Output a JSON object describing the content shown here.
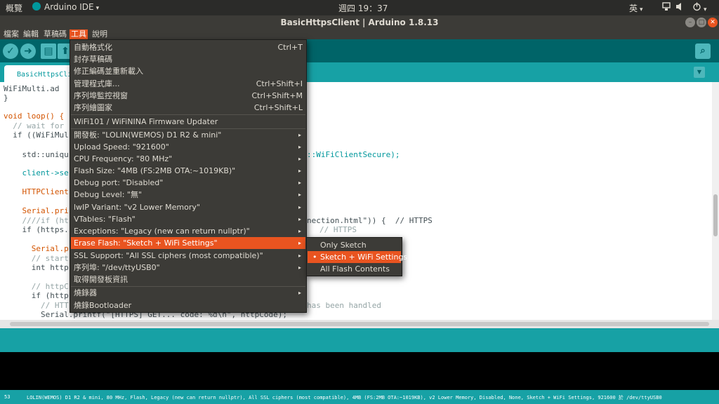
{
  "top_panel": {
    "activities": "概覽",
    "app_name": "Arduino IDE",
    "clock": "週四 19：37",
    "input_method": "英",
    "dropdown_arrow": "▾"
  },
  "window": {
    "title": "BasicHttpsClient | Arduino 1.8.13"
  },
  "menubar": [
    "檔案",
    "編輯",
    "草稿碼",
    "工具",
    "說明"
  ],
  "tab": {
    "label": "BasicHttpsClient"
  },
  "code_lines": [
    "WiFiMulti.ad",
    "}",
    "",
    "void loop() {",
    "  // wait for",
    "  if ((WiFiMul",
    "",
    "    std::uniqu",
    "",
    "    client->se",
    "",
    "    HTTPClient",
    "",
    "    Serial.pri",
    "    ////if (ht",
    "    if (https.",
    "",
    "      Serial.p",
    "      // start",
    "      int http",
    "",
    "      // httpC",
    "      if (http",
    "        // HTT",
    "        Serial.printf(\"[HTTPS] GET... code: %d\\n\", httpCode);"
  ],
  "code_right": {
    "secure": "::WiFiClientSecure);",
    "connection": "nection.html\")) {  // HTTPS",
    "https": "// HTTPS",
    "handled": "has been handled"
  },
  "tools_menu": {
    "items": [
      {
        "label": "自動格式化",
        "shortcut": "Ctrl+T"
      },
      {
        "label": "封存草稿碼",
        "shortcut": ""
      },
      {
        "label": "修正編碼並重新載入",
        "shortcut": ""
      },
      {
        "label": "管理程式庫...",
        "shortcut": "Ctrl+Shift+I"
      },
      {
        "label": "序列埠監控視窗",
        "shortcut": "Ctrl+Shift+M"
      },
      {
        "label": "序列繪圖家",
        "shortcut": "Ctrl+Shift+L"
      },
      {
        "label": "WiFi101 / WiFiNINA Firmware Updater",
        "shortcut": ""
      },
      {
        "label": "開發板: \"LOLIN(WEMOS) D1 R2 & mini\"",
        "shortcut": ""
      },
      {
        "label": "Upload Speed: \"921600\"",
        "shortcut": ""
      },
      {
        "label": "CPU Frequency: \"80 MHz\"",
        "shortcut": ""
      },
      {
        "label": "Flash Size: \"4MB (FS:2MB OTA:~1019KB)\"",
        "shortcut": ""
      },
      {
        "label": "Debug port: \"Disabled\"",
        "shortcut": ""
      },
      {
        "label": "Debug Level: \"無\"",
        "shortcut": ""
      },
      {
        "label": "lwIP Variant: \"v2 Lower Memory\"",
        "shortcut": ""
      },
      {
        "label": "VTables: \"Flash\"",
        "shortcut": ""
      },
      {
        "label": "Exceptions: \"Legacy (new can return nullptr)\"",
        "shortcut": ""
      },
      {
        "label": "Erase Flash: \"Sketch + WiFi Settings\"",
        "shortcut": ""
      },
      {
        "label": "SSL Support: \"All SSL ciphers (most compatible)\"",
        "shortcut": ""
      },
      {
        "label": "序列埠: \"/dev/ttyUSB0\"",
        "shortcut": ""
      },
      {
        "label": "取得開發板資訊",
        "shortcut": ""
      },
      {
        "label": "燒錄器",
        "shortcut": ""
      },
      {
        "label": "燒錄Bootloader",
        "shortcut": ""
      }
    ],
    "submenu_arrow": "▸"
  },
  "erase_submenu": {
    "items": [
      "Only Sketch",
      "Sketch + WiFi Settings",
      "All Flash Contents"
    ],
    "selected_marker": "•"
  },
  "footer": {
    "line_number": "53",
    "board_info": "LOLIN(WEMOS) D1 R2 & mini, 80 MHz, Flash, Legacy (new can return nullptr), All SSL ciphers (most compatible), 4MB (FS:2MB OTA:~1019KB), v2 Lower Memory, Disabled, None, Sketch + WiFi Settings, 921600 於 /dev/ttyUSB0"
  },
  "colors": {
    "accent": "#e95420",
    "arduino_teal": "#00979c",
    "arduino_dark_teal": "#006468"
  }
}
